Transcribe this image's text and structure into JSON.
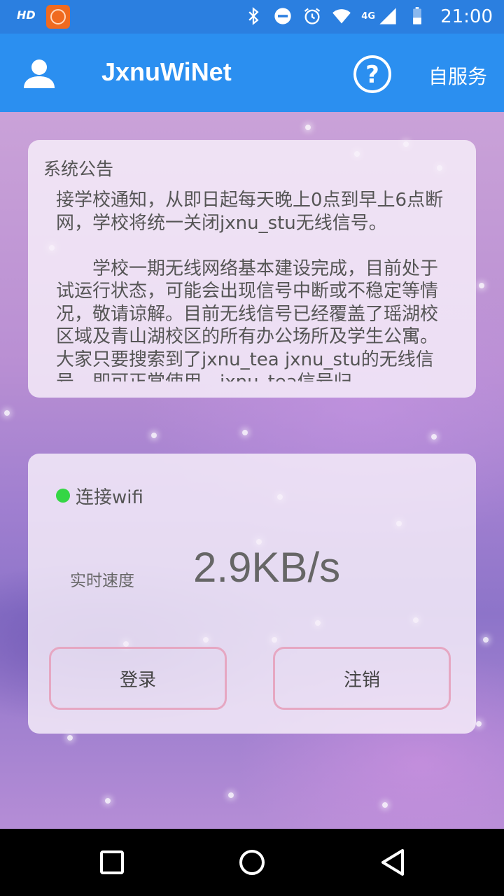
{
  "status_bar": {
    "network_label": "HD",
    "time": "21:00",
    "signal_label": "4G",
    "icons": [
      "bluetooth-icon",
      "do-not-disturb-icon",
      "alarm-icon",
      "wifi-icon",
      "signal-icon",
      "battery-icon"
    ]
  },
  "app_bar": {
    "title": "JxnuWiNet",
    "self_service_label": "自服务",
    "icons": [
      "user-icon",
      "help-icon"
    ]
  },
  "notice": {
    "label": "系统公告",
    "text": "接学校通知，从即日起每天晚上0点到早上6点断网，学校将统一关闭jxnu_stu无线信号。\n\n　　学校一期无线网络基本建设完成，目前处于试运行状态，可能会出现信号中断或不稳定等情况，敬请谅解。目前无线信号已经覆盖了瑶湖校区域及青山湖校区的所有办公场所及学生公寓。大家只要搜索到了jxnu_tea jxnu_stu的无线信号，即可正常使用。jxnu_tea信号归"
  },
  "connection": {
    "status_label": "连接wifi",
    "status_color": "#35d645",
    "speed_label": "实时速度",
    "speed_value": "2.9KB/s"
  },
  "buttons": {
    "login_label": "登录",
    "logout_label": "注销"
  },
  "colors": {
    "status_bar": "#2b7fe0",
    "app_bar": "#2b8ff0",
    "button_border": "#e6a7c2"
  }
}
